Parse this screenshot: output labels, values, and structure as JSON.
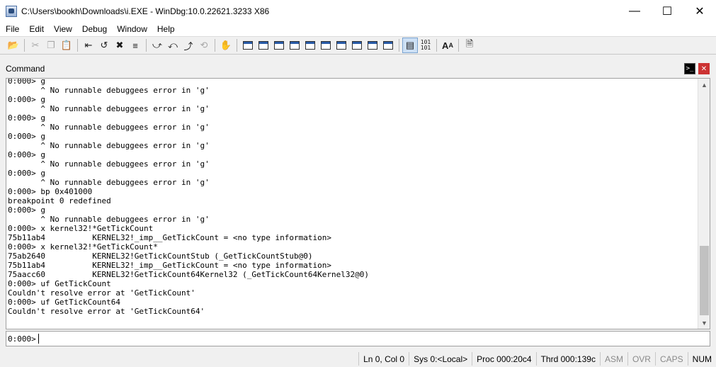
{
  "window": {
    "title": "C:\\Users\\bookh\\Downloads\\i.EXE - WinDbg:10.0.22621.3233 X86"
  },
  "menu": [
    "File",
    "Edit",
    "View",
    "Debug",
    "Window",
    "Help"
  ],
  "pane": {
    "title": "Command"
  },
  "output_lines": [
    "0:000> g",
    "       ^ No runnable debuggees error in 'g'",
    "0:000> g",
    "       ^ No runnable debuggees error in 'g'",
    "0:000> g",
    "       ^ No runnable debuggees error in 'g'",
    "0:000> g",
    "       ^ No runnable debuggees error in 'g'",
    "0:000> g",
    "       ^ No runnable debuggees error in 'g'",
    "0:000> g",
    "       ^ No runnable debuggees error in 'g'",
    "0:000> bp 0x401000",
    "breakpoint 0 redefined",
    "0:000> g",
    "       ^ No runnable debuggees error in 'g'",
    "0:000> x kernel32!*GetTickCount",
    "75b11ab4          KERNEL32!_imp__GetTickCount = <no type information>",
    "0:000> x kernel32!*GetTickCount*",
    "75ab2640          KERNEL32!GetTickCountStub (_GetTickCountStub@0)",
    "75b11ab4          KERNEL32!_imp__GetTickCount = <no type information>",
    "75aacc60          KERNEL32!GetTickCount64Kernel32 (_GetTickCount64Kernel32@0)",
    "0:000> uf GetTickCount",
    "Couldn't resolve error at 'GetTickCount'",
    "0:000> uf GetTickCount64",
    "Couldn't resolve error at 'GetTickCount64'"
  ],
  "command": {
    "prompt": "0:000>",
    "value": ""
  },
  "status": {
    "position": "Ln 0, Col 0",
    "sys": "Sys 0:<Local>",
    "proc": "Proc 000:20c4",
    "thrd": "Thrd 000:139c",
    "asm": "ASM",
    "ovr": "OVR",
    "caps": "CAPS",
    "num": "NUM"
  }
}
